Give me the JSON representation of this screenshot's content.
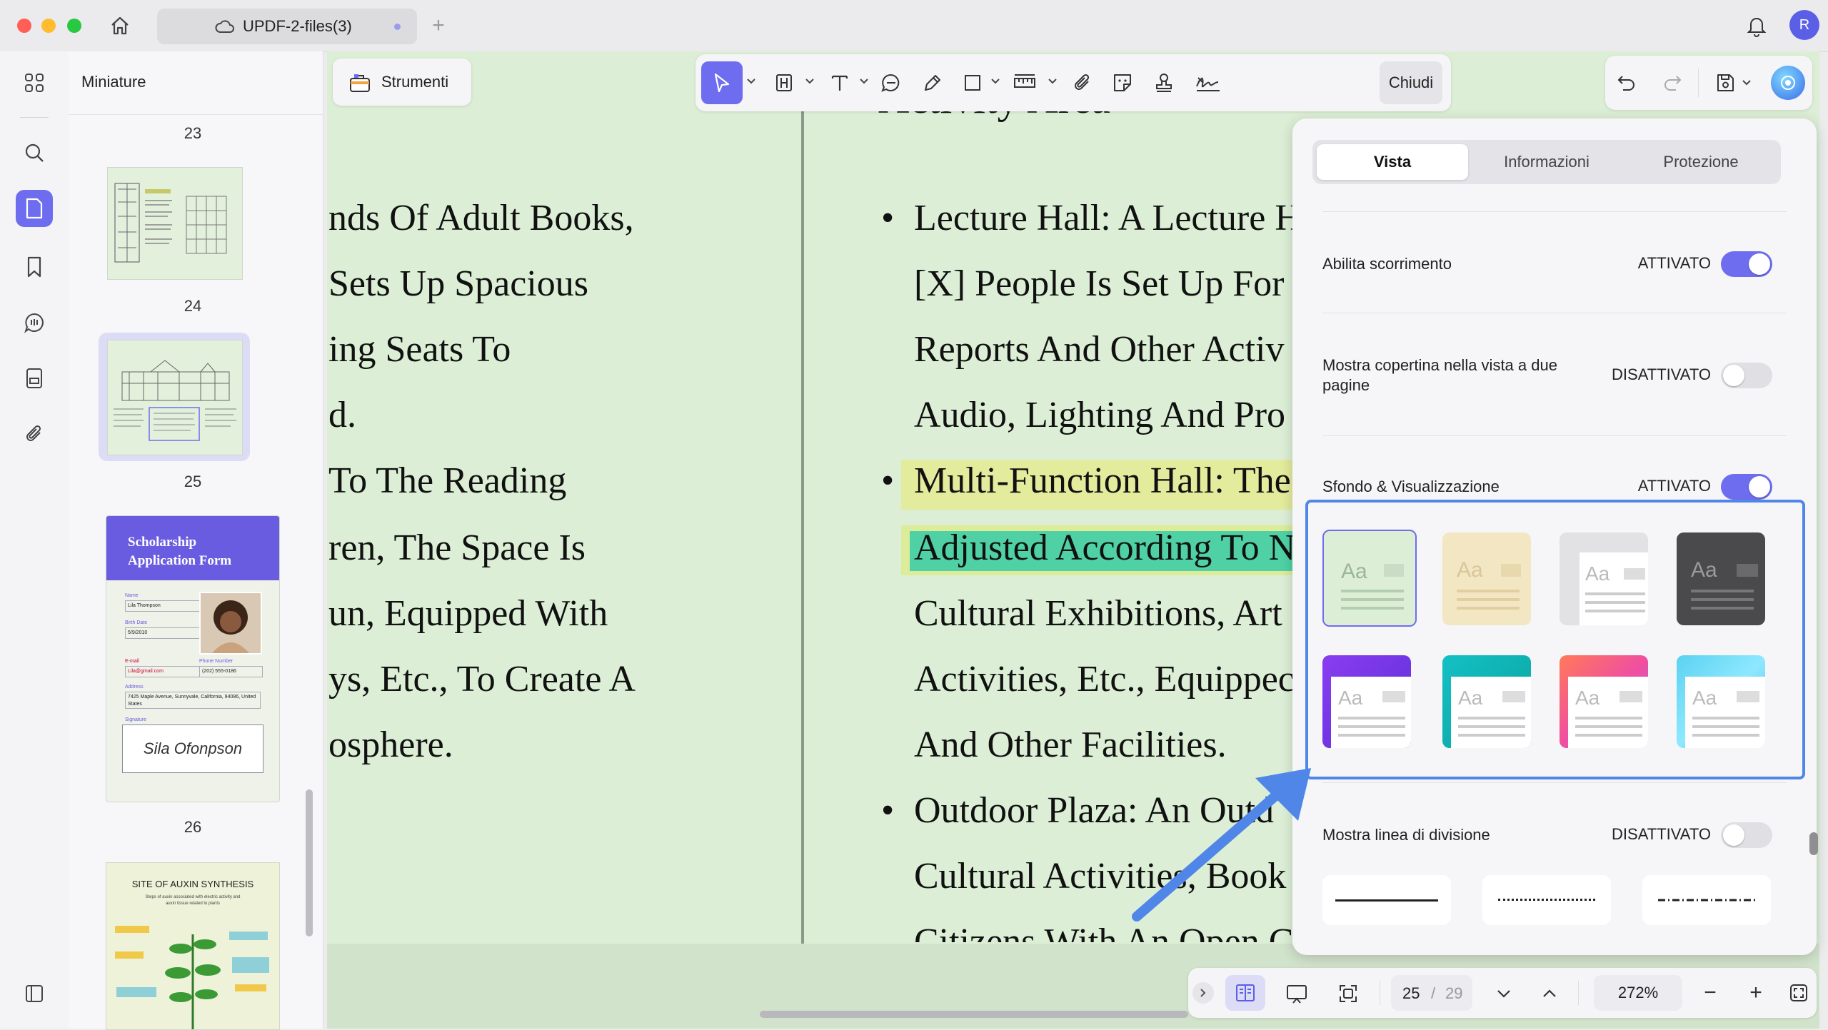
{
  "window": {
    "tab_title": "UPDF-2-files(3)",
    "avatar_letter": "R"
  },
  "sidebar": {
    "title": "Miniature",
    "page_labels": [
      "23",
      "24",
      "25",
      "26"
    ],
    "thumb25": {
      "heading": "Scholarship Application Form",
      "name_label": "Name",
      "name_value": "Lila Thompson",
      "birth_label": "Birth Date",
      "birth_value": "5/9/2010",
      "email_label": "E-mail",
      "email_value": "Lila@gmail.com",
      "phone_label": "Phone Number",
      "phone_value": "(202) 555-0186",
      "address_label": "Address",
      "address_value": "7425 Maple Avenue, Sunnyvale, California, 94086, United States",
      "signature_label": "Signature",
      "signature_value": "Sila Ofonpson"
    },
    "thumb26": {
      "heading": "SITE OF AUXIN SYNTHESIS",
      "sub": "Steps of auxin associated with electric activity and auxin tissue related to plants"
    }
  },
  "toolbar": {
    "tools_label": "Strumenti",
    "close_label": "Chiudi"
  },
  "document": {
    "left_lines": [
      "nds Of Adult Books,",
      "Sets Up Spacious",
      "ing Seats To",
      "d.",
      " To The Reading",
      "ren, The Space Is",
      "un, Equipped With",
      "ys, Etc., To Create A",
      "osphere."
    ],
    "heading_partial": "Activity Area",
    "right_lines": [
      {
        "bullet": true,
        "text": "Lecture Hall: A Lecture H"
      },
      {
        "bullet": false,
        "text": "[X] People Is Set Up For"
      },
      {
        "bullet": false,
        "text": "Reports And Other Activ"
      },
      {
        "bullet": false,
        "text": "Audio, Lighting And Pro"
      },
      {
        "bullet": true,
        "text": "Multi-Function Hall: The"
      },
      {
        "bullet": false,
        "text": "Adjusted According To N"
      },
      {
        "bullet": false,
        "text": "Cultural Exhibitions, Art"
      },
      {
        "bullet": false,
        "text": "Activities, Etc., Equippec"
      },
      {
        "bullet": false,
        "text": "And Other Facilities."
      },
      {
        "bullet": true,
        "text": "Outdoor Plaza: An Outd"
      },
      {
        "bullet": false,
        "text": "Cultural Activities, Book"
      },
      {
        "bullet": false,
        "text": "Citizens With An Open C"
      }
    ]
  },
  "panel": {
    "tabs": [
      "Vista",
      "Informazioni",
      "Protezione"
    ],
    "active_tab": "Vista",
    "scroll": {
      "label": "Abilita scorrimento",
      "state": "ATTIVATO",
      "on": true
    },
    "cover": {
      "label": "Mostra copertina nella vista a due pagine",
      "state": "DISATTIVATO",
      "on": false
    },
    "background": {
      "label": "Sfondo & Visualizzazione",
      "state": "ATTIVATO",
      "on": true
    },
    "swatch_text": "Aa",
    "divider": {
      "label": "Mostra linea di divisione",
      "state": "DISATTIVATO",
      "on": false
    }
  },
  "bottombar": {
    "current_page": "25",
    "separator": "/",
    "total_pages": "29",
    "zoom": "272%"
  },
  "colors": {
    "accent": "#6e6df0",
    "highlight_yellow": "#e3eb9c",
    "highlight_teal": "#4fd1a5",
    "callout": "#4f86e8",
    "page_bg": "#dcefd6"
  }
}
